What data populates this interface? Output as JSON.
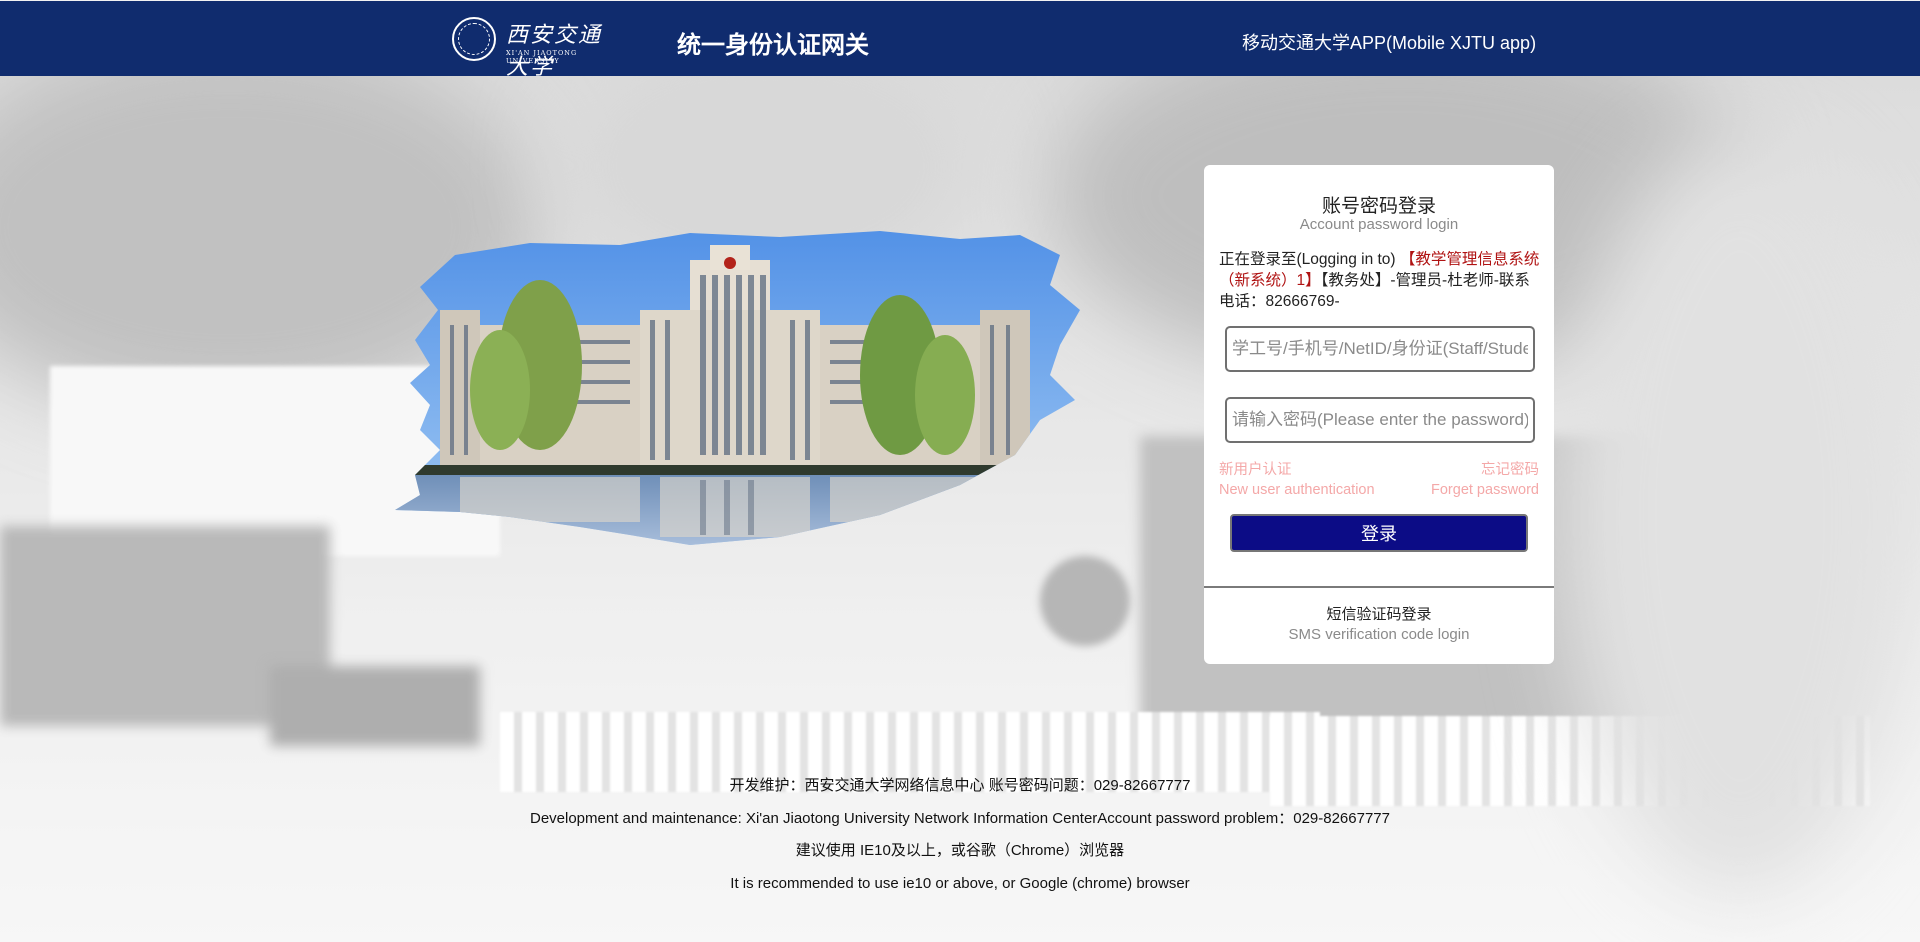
{
  "header": {
    "logo_cn": "西安交通大学",
    "logo_en": "XI'AN JIAOTONG UNIVERSITY",
    "title": "统一身份认证网关",
    "mobile_app": "移动交通大学APP(Mobile XJTU app)"
  },
  "login": {
    "title_cn": "账号密码登录",
    "title_en": "Account password login",
    "target_prefix": "正在登录至(Logging in to) ",
    "target_system": "【教学管理信息系统（新系统）1】",
    "target_rest": "【教务处】-管理员-杜老师-联系电话：82666769-",
    "username_placeholder": "学工号/手机号/NetID/身份证(Staff/Student ID)",
    "password_placeholder": "请输入密码(Please enter the password)",
    "new_user_cn": "新用户认证",
    "new_user_en": "New user authentication",
    "forgot_cn": "忘记密码",
    "forgot_en": "Forget password",
    "submit_label": "登录",
    "sms_cn": "短信验证码登录",
    "sms_en": "SMS verification code login"
  },
  "footer": {
    "line1": "开发维护：西安交通大学网络信息中心 账号密码问题：029-82667777",
    "line2": "Development and maintenance: Xi'an Jiaotong University Network Information CenterAccount password problem：029-82667777",
    "line3": "建议使用 IE10及以上，或谷歌（Chrome）浏览器",
    "line4": "It is recommended to use ie10 or above, or Google (chrome) browser"
  },
  "colors": {
    "header_bg": "#102c6e",
    "login_button": "#0c0c86",
    "system_name": "#b01313",
    "links": "#f4a8a8"
  }
}
